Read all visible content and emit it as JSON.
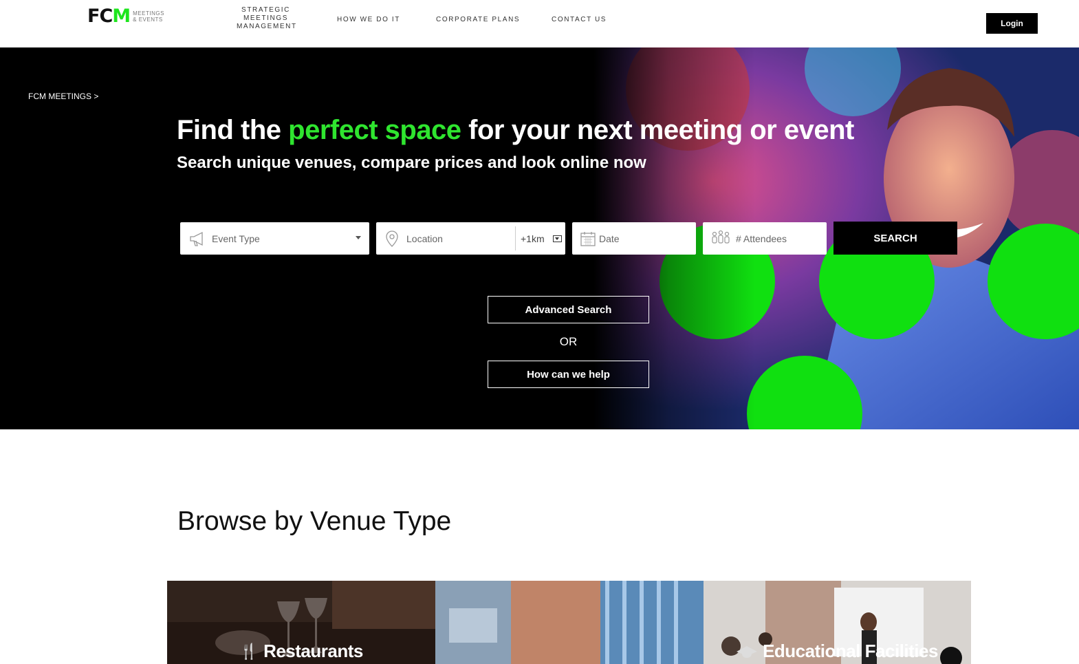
{
  "header": {
    "logo_mark_left": "FC",
    "logo_mark_right": "M",
    "logo_sub_1": "MEETINGS",
    "logo_sub_2": "& EVENTS",
    "nav": [
      {
        "line1": "STRATEGIC",
        "line2": "MEETINGS",
        "line3": "MANAGEMENT"
      },
      {
        "label": "HOW WE DO IT"
      },
      {
        "label": "CORPORATE PLANS"
      },
      {
        "label": "CONTACT US"
      }
    ],
    "login_label": "Login"
  },
  "hero": {
    "breadcrumb": "FCM MEETINGS >",
    "headline_pre": "Find the ",
    "headline_accent": "perfect space",
    "headline_post": " for your next meeting or event",
    "subline": "Search unique venues, compare prices and look online now",
    "search": {
      "event_type_placeholder": "Event Type",
      "location_placeholder": "Location",
      "radius_value": "+1km",
      "date_placeholder": "Date",
      "attendees_placeholder": "# Attendees",
      "search_label": "SEARCH"
    },
    "advanced_search_label": "Advanced Search",
    "or_label": "OR",
    "help_label": "How can we help"
  },
  "browse": {
    "title": "Browse by Venue Type",
    "tiles": [
      {
        "label": "Restaurants",
        "icon": "fork-knife-icon"
      },
      {
        "label": "",
        "icon": ""
      },
      {
        "label": "Educational Facilities",
        "icon": "graduation-cap-icon"
      }
    ]
  },
  "colors": {
    "accent_green": "#2fe52f",
    "button_black": "#000000",
    "hero_background": "#000000"
  }
}
